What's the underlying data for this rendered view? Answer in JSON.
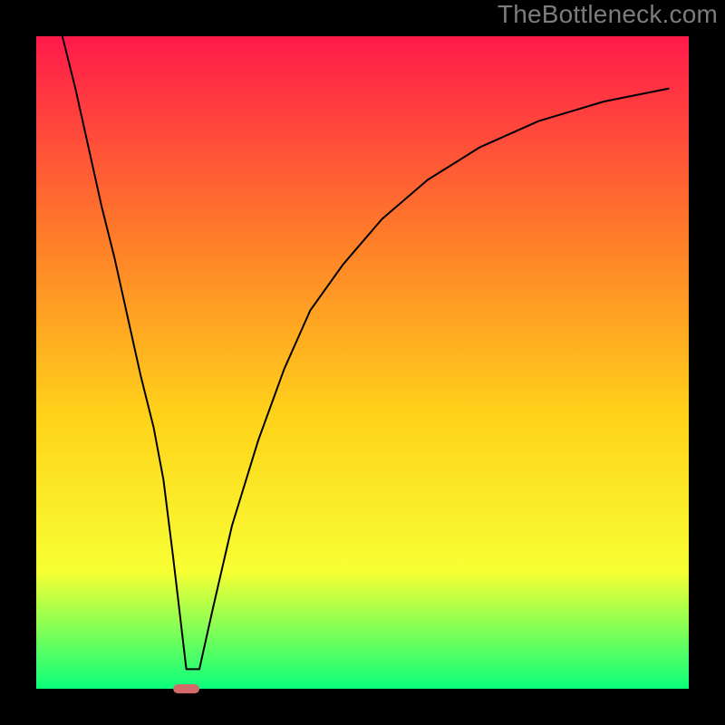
{
  "attribution": "TheBottleneck.com",
  "chart_data": {
    "type": "line",
    "title": "",
    "xlabel": "",
    "ylabel": "",
    "xlim": [
      0,
      100
    ],
    "ylim": [
      0,
      100
    ],
    "grid": false,
    "legend": false,
    "background_gradient": {
      "top": "#ff1a4b",
      "upper_mid": "#ff7a2a",
      "mid": "#ffd21a",
      "lower_mid": "#f7ff33",
      "bottom": "#0bff7b"
    },
    "series": [
      {
        "name": "bottleneck-curve",
        "color": "#000000",
        "stroke_width": 2,
        "x": [
          4,
          6,
          8,
          10,
          12,
          14,
          16,
          18,
          19.5,
          21,
          23,
          25,
          27,
          30,
          34,
          38,
          42,
          47,
          53,
          60,
          68,
          77,
          87,
          97
        ],
        "values": [
          100,
          92,
          83,
          74,
          66,
          57,
          48,
          40,
          32,
          20,
          3,
          3,
          12,
          25,
          38,
          49,
          58,
          65,
          72,
          78,
          83,
          87,
          90,
          92
        ]
      }
    ],
    "markers": [
      {
        "name": "optimum-marker",
        "shape": "rounded-rect",
        "x": 23,
        "y": 0,
        "width_pct": 4.0,
        "height_pct": 1.4,
        "color": "#d36a6a"
      }
    ],
    "frame": {
      "border_color": "#000000",
      "border_width_pct": 5.0
    }
  }
}
